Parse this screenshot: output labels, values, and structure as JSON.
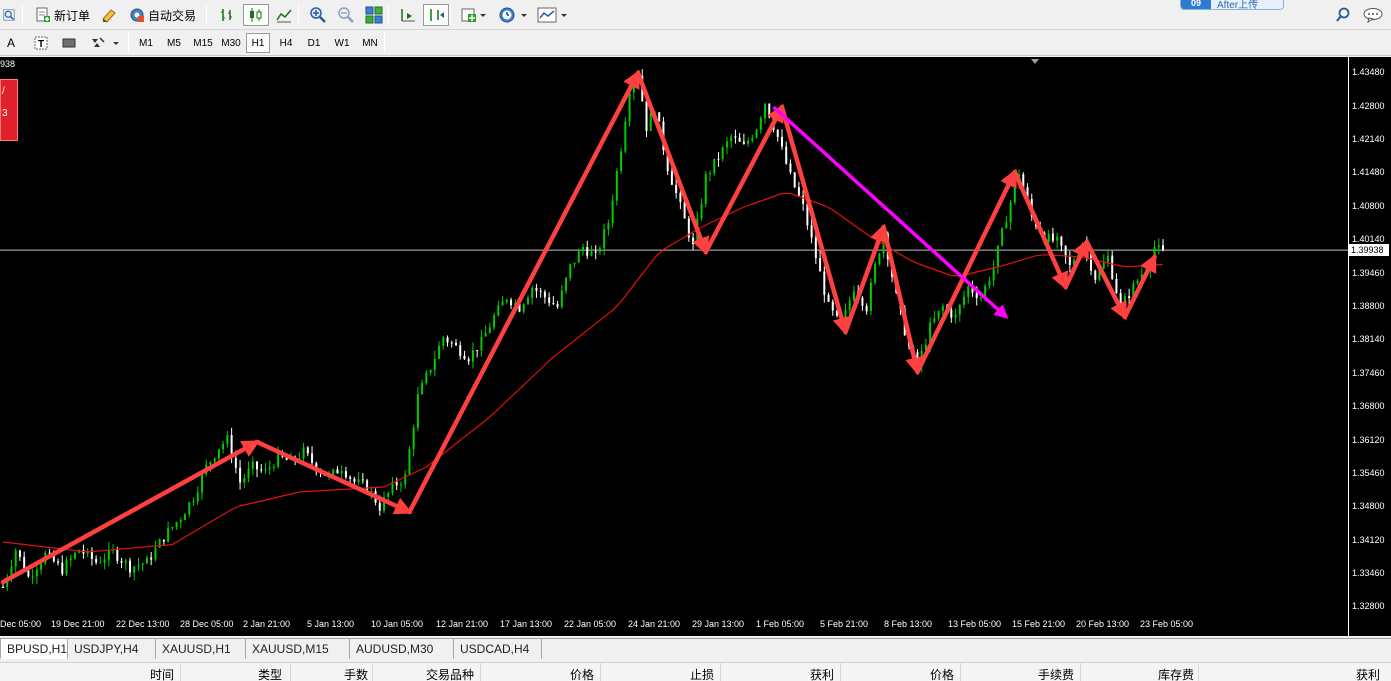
{
  "toolbar": {
    "new_order_label": "新订单",
    "auto_trade_label": "自动交易"
  },
  "upload_badge": {
    "number": "09",
    "text": "After上传"
  },
  "timeframes": [
    "M1",
    "M5",
    "M15",
    "M30",
    "H1",
    "H4",
    "D1",
    "W1",
    "MN"
  ],
  "active_timeframe": "H1",
  "chart_header": {
    "price_fragment": "938",
    "panel_lines": [
      "/",
      "3"
    ]
  },
  "bid_price": "1.39938",
  "colors": {
    "bull": "#00cc00",
    "bear": "#ffffff",
    "ma": "#e01010",
    "arrow": "#ff4040",
    "magenta": "#ff00ff",
    "background": "#000000"
  },
  "chart_data": {
    "type": "candlestick",
    "symbol": "GBPUSD",
    "timeframe": "H1",
    "y_ticks": [
      "1.43480",
      "1.42800",
      "1.42140",
      "1.41480",
      "1.40800",
      "1.40140",
      "1.39460",
      "1.38800",
      "1.38140",
      "1.37460",
      "1.36800",
      "1.36120",
      "1.35460",
      "1.34800",
      "1.34120",
      "1.33460",
      "1.32800"
    ],
    "ylim": [
      1.326,
      1.438
    ],
    "x_ticks": [
      "Dec 05:00",
      "19 Dec 21:00",
      "22 Dec 13:00",
      "28 Dec 05:00",
      "2 Jan 21:00",
      "5 Jan 13:00",
      "10 Jan 05:00",
      "12 Jan 21:00",
      "17 Jan 13:00",
      "22 Jan 05:00",
      "24 Jan 21:00",
      "29 Jan 13:00",
      "1 Feb 05:00",
      "5 Feb 21:00",
      "8 Feb 13:00",
      "13 Feb 05:00",
      "15 Feb 21:00",
      "20 Feb 13:00",
      "23 Feb 05:00"
    ],
    "price_path": [
      [
        0,
        1.332
      ],
      [
        3,
        1.3395
      ],
      [
        6,
        1.334
      ],
      [
        10,
        1.3385
      ],
      [
        14,
        1.3355
      ],
      [
        18,
        1.3395
      ],
      [
        22,
        1.337
      ],
      [
        26,
        1.339
      ],
      [
        30,
        1.336
      ],
      [
        34,
        1.337
      ],
      [
        38,
        1.342
      ],
      [
        42,
        1.346
      ],
      [
        45,
        1.35
      ],
      [
        48,
        1.356
      ],
      [
        51,
        1.36
      ],
      [
        53,
        1.3615
      ],
      [
        56,
        1.353
      ],
      [
        59,
        1.356
      ],
      [
        62,
        1.355
      ],
      [
        65,
        1.358
      ],
      [
        68,
        1.357
      ],
      [
        71,
        1.359
      ],
      [
        74,
        1.356
      ],
      [
        77,
        1.354
      ],
      [
        80,
        1.356
      ],
      [
        83,
        1.353
      ],
      [
        86,
        1.352
      ],
      [
        89,
        1.348
      ],
      [
        92,
        1.352
      ],
      [
        95,
        1.354
      ],
      [
        98,
        1.37
      ],
      [
        101,
        1.376
      ],
      [
        104,
        1.382
      ],
      [
        107,
        1.38
      ],
      [
        110,
        1.378
      ],
      [
        113,
        1.381
      ],
      [
        116,
        1.386
      ],
      [
        119,
        1.39
      ],
      [
        122,
        1.388
      ],
      [
        125,
        1.392
      ],
      [
        128,
        1.39
      ],
      [
        131,
        1.388
      ],
      [
        134,
        1.396
      ],
      [
        137,
        1.4
      ],
      [
        140,
        1.398
      ],
      [
        143,
        1.405
      ],
      [
        146,
        1.42
      ],
      [
        148,
        1.432
      ],
      [
        150,
        1.4348
      ],
      [
        152,
        1.424
      ],
      [
        154,
        1.428
      ],
      [
        157,
        1.416
      ],
      [
        160,
        1.408
      ],
      [
        163,
        1.4
      ],
      [
        166,
        1.414
      ],
      [
        169,
        1.418
      ],
      [
        172,
        1.422
      ],
      [
        175,
        1.42
      ],
      [
        178,
        1.424
      ],
      [
        180,
        1.429
      ],
      [
        183,
        1.422
      ],
      [
        186,
        1.414
      ],
      [
        189,
        1.408
      ],
      [
        192,
        1.398
      ],
      [
        195,
        1.388
      ],
      [
        198,
        1.384
      ],
      [
        201,
        1.392
      ],
      [
        204,
        1.388
      ],
      [
        206,
        1.396
      ],
      [
        208,
        1.403
      ],
      [
        211,
        1.39
      ],
      [
        214,
        1.38
      ],
      [
        216,
        1.376
      ],
      [
        219,
        1.384
      ],
      [
        222,
        1.388
      ],
      [
        225,
        1.386
      ],
      [
        228,
        1.392
      ],
      [
        231,
        1.39
      ],
      [
        234,
        1.396
      ],
      [
        237,
        1.406
      ],
      [
        240,
        1.415
      ],
      [
        243,
        1.406
      ],
      [
        246,
        1.402
      ],
      [
        249,
        1.401
      ],
      [
        252,
        1.396
      ],
      [
        255,
        1.401
      ],
      [
        258,
        1.394
      ],
      [
        261,
        1.398
      ],
      [
        264,
        1.388
      ],
      [
        267,
        1.392
      ],
      [
        270,
        1.396
      ],
      [
        272,
        1.4
      ],
      [
        274,
        1.3988
      ]
    ],
    "ma_path": [
      [
        0,
        1.341
      ],
      [
        20,
        1.339
      ],
      [
        40,
        1.3405
      ],
      [
        55,
        1.348
      ],
      [
        70,
        1.351
      ],
      [
        90,
        1.352
      ],
      [
        100,
        1.356
      ],
      [
        115,
        1.366
      ],
      [
        130,
        1.378
      ],
      [
        145,
        1.388
      ],
      [
        155,
        1.399
      ],
      [
        165,
        1.404
      ],
      [
        175,
        1.408
      ],
      [
        185,
        1.411
      ],
      [
        195,
        1.408
      ],
      [
        205,
        1.402
      ],
      [
        215,
        1.397
      ],
      [
        225,
        1.394
      ],
      [
        235,
        1.396
      ],
      [
        245,
        1.3985
      ],
      [
        255,
        1.398
      ],
      [
        265,
        1.396
      ],
      [
        274,
        1.3965
      ]
    ],
    "bar_count": 275,
    "annotations": {
      "arrows_red": [
        [
          [
            0,
            1.333
          ],
          [
            60,
            1.361
          ]
        ],
        [
          [
            60,
            1.361
          ],
          [
            96,
            1.347
          ]
        ],
        [
          [
            96,
            1.347
          ],
          [
            150,
            1.4348
          ]
        ],
        [
          [
            150,
            1.4348
          ],
          [
            166,
            1.399
          ]
        ],
        [
          [
            166,
            1.399
          ],
          [
            184,
            1.428
          ]
        ],
        [
          [
            184,
            1.428
          ],
          [
            199,
            1.383
          ]
        ],
        [
          [
            199,
            1.383
          ],
          [
            208,
            1.404
          ]
        ],
        [
          [
            208,
            1.404
          ],
          [
            216,
            1.375
          ]
        ],
        [
          [
            216,
            1.375
          ],
          [
            239,
            1.415
          ]
        ],
        [
          [
            239,
            1.415
          ],
          [
            251,
            1.392
          ]
        ],
        [
          [
            251,
            1.392
          ],
          [
            256,
            1.401
          ]
        ],
        [
          [
            256,
            1.401
          ],
          [
            265,
            1.386
          ]
        ],
        [
          [
            265,
            1.386
          ],
          [
            272,
            1.398
          ]
        ]
      ],
      "arrow_magenta": [
        [
          182,
          1.428
        ],
        [
          237,
          1.386
        ]
      ]
    }
  },
  "tabs": [
    "BPUSD,H1",
    "USDJPY,H4",
    "XAUUSD,H1",
    "XAUUSD,M15",
    "AUDUSD,M30",
    "USDCAD,H4"
  ],
  "active_tab": "BPUSD,H1",
  "columns": [
    "时间",
    "类型",
    "手数",
    "交易品种",
    "价格",
    "止损",
    "获利",
    "价格",
    "手续费",
    "库存费",
    "获利"
  ]
}
